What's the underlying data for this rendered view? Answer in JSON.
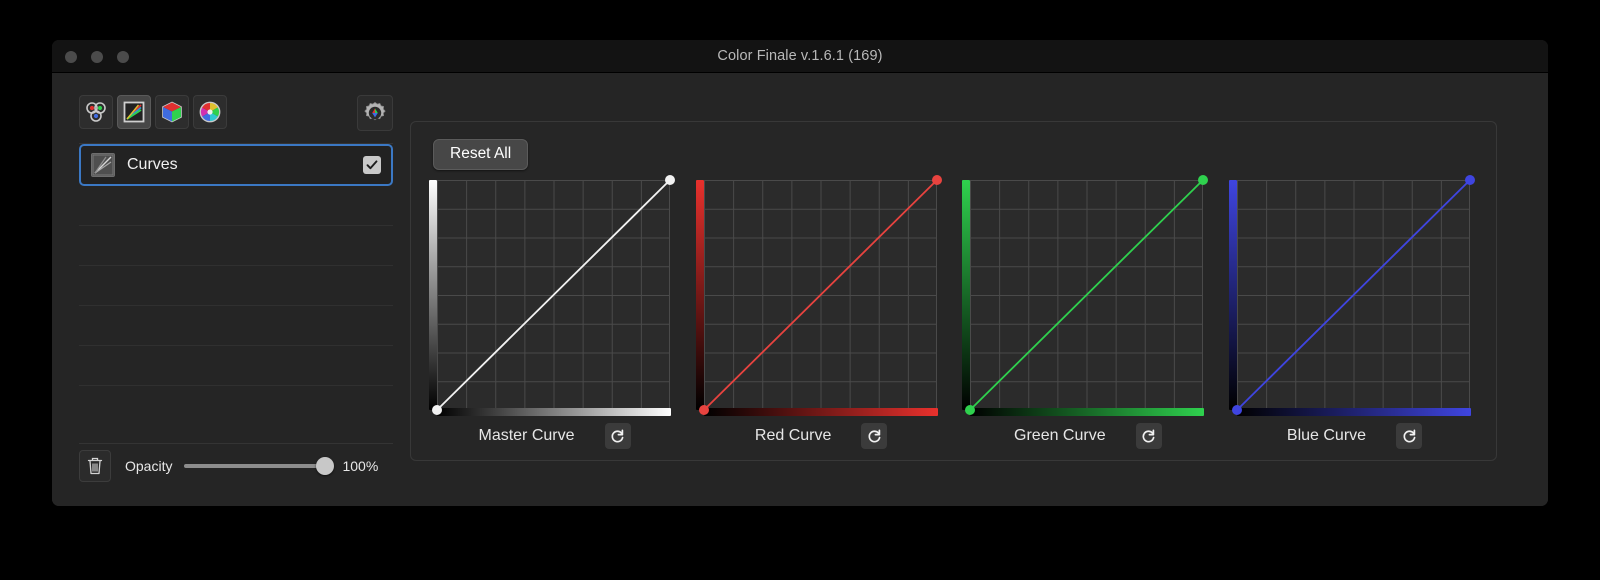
{
  "window": {
    "title": "Color Finale v.1.6.1 (169)",
    "traffic_lights": [
      "close",
      "minimize",
      "zoom"
    ]
  },
  "sidebar": {
    "tools": [
      {
        "name": "color-wheels-tool",
        "icon": "three-circles-rgb-icon",
        "active": false
      },
      {
        "name": "curves-tool",
        "icon": "diagonal-rainbow-square-icon",
        "active": true
      },
      {
        "name": "lut-cube-tool",
        "icon": "rgb-cube-icon",
        "active": false
      },
      {
        "name": "color-wheel-tool",
        "icon": "color-wheel-icon",
        "active": false
      }
    ],
    "settings_button": {
      "name": "settings-gear-button",
      "icon": "gear-rgb-icon"
    },
    "layers": [
      {
        "label": "Curves",
        "enabled": true,
        "selected": true
      }
    ],
    "empty_rows": 6,
    "footer": {
      "delete_icon": "trash-icon",
      "opacity_label": "Opacity",
      "opacity_value": "100%",
      "opacity_percent": 100
    }
  },
  "main": {
    "reset_all_label": "Reset All",
    "reset_icon": "refresh-circular-arrow-icon"
  },
  "chart_data": [
    {
      "type": "line",
      "title": "Master Curve",
      "color": "#f2f2f2",
      "ramp_start": "#000000",
      "ramp_end": "#ffffff",
      "x": [
        0,
        1
      ],
      "y": [
        0,
        1
      ],
      "xlim": [
        0,
        1
      ],
      "ylim": [
        0,
        1
      ],
      "grid": true,
      "grid_divisions": 8,
      "control_points": [
        [
          0,
          0
        ],
        [
          1,
          1
        ]
      ],
      "xlabel": "",
      "ylabel": ""
    },
    {
      "type": "line",
      "title": "Red Curve",
      "color": "#e8433f",
      "ramp_start": "#000000",
      "ramp_end": "#e8312d",
      "x": [
        0,
        1
      ],
      "y": [
        0,
        1
      ],
      "xlim": [
        0,
        1
      ],
      "ylim": [
        0,
        1
      ],
      "grid": true,
      "grid_divisions": 8,
      "control_points": [
        [
          0,
          0
        ],
        [
          1,
          1
        ]
      ],
      "xlabel": "",
      "ylabel": ""
    },
    {
      "type": "line",
      "title": "Green Curve",
      "color": "#2fd14e",
      "ramp_start": "#000000",
      "ramp_end": "#2fd14e",
      "x": [
        0,
        1
      ],
      "y": [
        0,
        1
      ],
      "xlim": [
        0,
        1
      ],
      "ylim": [
        0,
        1
      ],
      "grid": true,
      "grid_divisions": 8,
      "control_points": [
        [
          0,
          0
        ],
        [
          1,
          1
        ]
      ],
      "xlabel": "",
      "ylabel": ""
    },
    {
      "type": "line",
      "title": "Blue Curve",
      "color": "#3f45e0",
      "ramp_start": "#000000",
      "ramp_end": "#3f45e0",
      "x": [
        0,
        1
      ],
      "y": [
        0,
        1
      ],
      "xlim": [
        0,
        1
      ],
      "ylim": [
        0,
        1
      ],
      "grid": true,
      "grid_divisions": 8,
      "control_points": [
        [
          0,
          0
        ],
        [
          1,
          1
        ]
      ],
      "xlabel": "",
      "ylabel": ""
    }
  ],
  "colors": {
    "window_bg": "#252525",
    "titlebar_bg": "#131313",
    "panel_bg": "#262626",
    "selection_blue": "#3b78c4",
    "grid_line": "#4a4a4a",
    "red": "#e8433f",
    "green": "#2fd14e",
    "blue": "#3f45e0",
    "master": "#f2f2f2"
  }
}
